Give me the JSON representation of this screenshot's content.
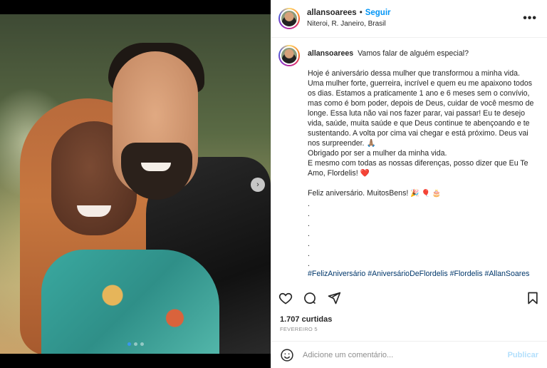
{
  "post": {
    "username": "allansoarees",
    "follow_label": "Seguir",
    "separator": "•",
    "location": "Niteroi, R. Janeiro, Brasil",
    "more_label": "•••"
  },
  "caption": {
    "username": "allansoarees",
    "first_line": "Vamos falar de alguém especial?",
    "body": "Hoje é aniversário dessa mulher que transformou a minha vida.\nUma mulher forte, guerreira, incrível e quem eu me apaixono todos os dias. Estamos a praticamente 1 ano e 6 meses sem o convívio, mas como é bom poder, depois de Deus, cuidar de você mesmo de longe. Essa luta não vai nos fazer parar, vai passar! Eu te desejo vida, saúde, muita saúde e que Deus continue te abençoando e te sustentando. A volta por cima vai chegar e está próximo. Deus vai nos surpreender. 🙏🏽\nObrigado por ser a mulher da minha vida.\nE mesmo com todas as nossas diferenças, posso dizer que Eu Te Amo, Flordelis!",
    "heart": "❤️",
    "birthday_line": "Feliz aniversário. MuitosBens!",
    "birthday_emojis": "🎉 🎈 🎂",
    "dots": [
      ".",
      ".",
      ".",
      ".",
      ".",
      ".",
      "."
    ],
    "hashtags": "#FelizAniversário #AniversárioDeFlordelis #Flordelis #AllanSoares"
  },
  "engagement": {
    "likes": "1.707 curtidas",
    "date": "FEVEREIRO 5"
  },
  "comment": {
    "placeholder": "Adicione um comentário...",
    "publish_label": "Publicar"
  },
  "carousel": {
    "next_icon": "›",
    "slide_count": 3,
    "active_slide": 1
  },
  "colors": {
    "follow": "#0095f6",
    "hashtag": "#00376b",
    "publish_disabled": "#b2dffc"
  }
}
